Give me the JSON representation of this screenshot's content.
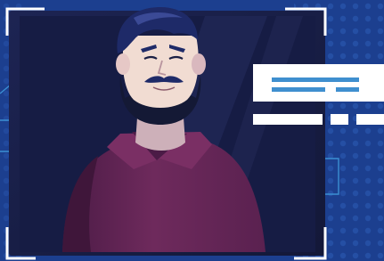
{
  "colors": {
    "background": "#1c3f8f",
    "dots": "#2d5cb6",
    "frame_dark": "#141a3c",
    "frame_inner": "#1a2050",
    "corner_marks": "#ffffff",
    "skin": "#f1dcd2",
    "skin_shadow": "#cdb0b9",
    "hair": "#1e2a68",
    "beard": "#141935",
    "shirt": "#6c2858",
    "shirt_dark": "#4a1a40",
    "card": "#ffffff",
    "card_lines": "#3f8fcf",
    "bracket": "#3b8fd3"
  },
  "icons": {
    "person": "bearded-man-illustration",
    "card": "id-card-placeholder-icon",
    "progress": "dashed-loading-bar-icon"
  }
}
